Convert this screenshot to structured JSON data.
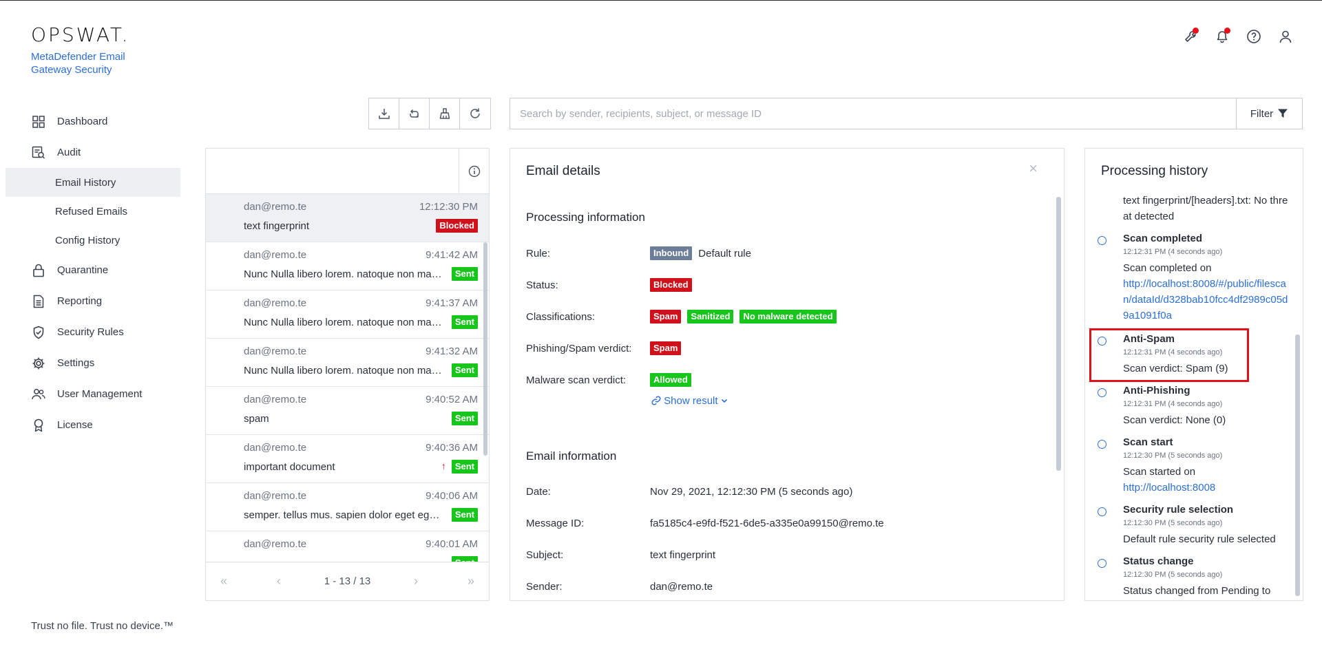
{
  "brand": {
    "logo": "OPSWAT.",
    "product": "MetaDefender Email Gateway Security"
  },
  "topbar": {
    "icons": [
      "wrench-icon",
      "bell-icon",
      "help-icon",
      "user-icon"
    ]
  },
  "sidebar": {
    "items": [
      {
        "label": "Dashboard",
        "icon": "dashboard-icon"
      },
      {
        "label": "Audit",
        "icon": "audit-icon"
      },
      {
        "label": "Email History",
        "sub": true,
        "active": true
      },
      {
        "label": "Refused Emails",
        "sub": true
      },
      {
        "label": "Config History",
        "sub": true
      },
      {
        "label": "Quarantine",
        "icon": "lock-icon"
      },
      {
        "label": "Reporting",
        "icon": "document-icon"
      },
      {
        "label": "Security Rules",
        "icon": "shield-check-icon"
      },
      {
        "label": "Settings",
        "icon": "gear-icon"
      },
      {
        "label": "User Management",
        "icon": "users-icon"
      },
      {
        "label": "License",
        "icon": "award-icon"
      }
    ],
    "footer": "Trust no file. Trust no device.™"
  },
  "search": {
    "placeholder": "Search by sender, recipients, subject, or message ID",
    "filter_label": "Filter"
  },
  "email_list": {
    "rows": [
      {
        "from": "dan@remo.te",
        "time": "12:12:30 PM",
        "subject": "text fingerprint",
        "status": "Blocked",
        "selected": true
      },
      {
        "from": "dan@remo.te",
        "time": "9:41:42 AM",
        "subject": "Nunc Nulla libero lorem. natoque non massa",
        "status": "Sent"
      },
      {
        "from": "dan@remo.te",
        "time": "9:41:37 AM",
        "subject": "Nunc Nulla libero lorem. natoque non massa",
        "status": "Sent"
      },
      {
        "from": "dan@remo.te",
        "time": "9:41:32 AM",
        "subject": "Nunc Nulla libero lorem. natoque non massa",
        "status": "Sent"
      },
      {
        "from": "dan@remo.te",
        "time": "9:40:52 AM",
        "subject": "spam",
        "status": "Sent"
      },
      {
        "from": "dan@remo.te",
        "time": "9:40:36 AM",
        "subject": "important document",
        "status": "Sent",
        "priority": true
      },
      {
        "from": "dan@remo.te",
        "time": "9:40:06 AM",
        "subject": "semper. tellus mus. sapien dolor eget egestas",
        "status": "Sent"
      },
      {
        "from": "dan@remo.te",
        "time": "9:40:01 AM",
        "subject": "",
        "status": "Sent"
      }
    ],
    "pagination": "1 - 13 / 13"
  },
  "details": {
    "title": "Email details",
    "processing_title": "Processing information",
    "rule_label": "Rule:",
    "rule_badge": "Inbound",
    "rule_value": "Default rule",
    "status_label": "Status:",
    "status_badge": "Blocked",
    "class_label": "Classifications:",
    "class_badges": [
      "Spam",
      "Sanitized",
      "No malware detected"
    ],
    "phish_label": "Phishing/Spam verdict:",
    "phish_badge": "Spam",
    "malware_label": "Malware scan verdict:",
    "malware_badge": "Allowed",
    "show_result": "Show result",
    "email_info_title": "Email information",
    "date_label": "Date:",
    "date_value": "Nov 29, 2021, 12:12:30 PM (5 seconds ago)",
    "msgid_label": "Message ID:",
    "msgid_value": "fa5185c4-e9fd-f521-6de5-a335e0a99150@remo.te",
    "subject_label": "Subject:",
    "subject_value": "text fingerprint",
    "sender_label": "Sender:",
    "sender_value": "dan@remo.te"
  },
  "history": {
    "title": "Processing history",
    "top_text": "text fingerprint/[headers].txt: No threat detected",
    "items": [
      {
        "title": "Scan completed",
        "time": "12:12:31 PM (4 seconds ago)",
        "desc": "Scan completed on",
        "link": "http://localhost:8008/#/public/filescan/dataId/d328bab10fcc4df2989c05d9a1091f0a"
      },
      {
        "title": "Anti-Spam",
        "time": "12:12:31 PM (4 seconds ago)",
        "desc": "Scan verdict: Spam (9)"
      },
      {
        "title": "Anti-Phishing",
        "time": "12:12:31 PM (4 seconds ago)",
        "desc": "Scan verdict: None (0)"
      },
      {
        "title": "Scan start",
        "time": "12:12:30 PM (5 seconds ago)",
        "desc": "Scan started on",
        "link": "http://localhost:8008"
      },
      {
        "title": "Security rule selection",
        "time": "12:12:30 PM (5 seconds ago)",
        "desc": "Default rule security rule selected"
      },
      {
        "title": "Status change",
        "time": "12:12:30 PM (5 seconds ago)",
        "desc": "Status changed from Pending to"
      }
    ]
  },
  "colors": {
    "accent": "#2c6fd8",
    "blocked": "#d0111b",
    "sent": "#18c51b",
    "inbound": "#6c7d9a",
    "highlight": "#e0101b"
  }
}
